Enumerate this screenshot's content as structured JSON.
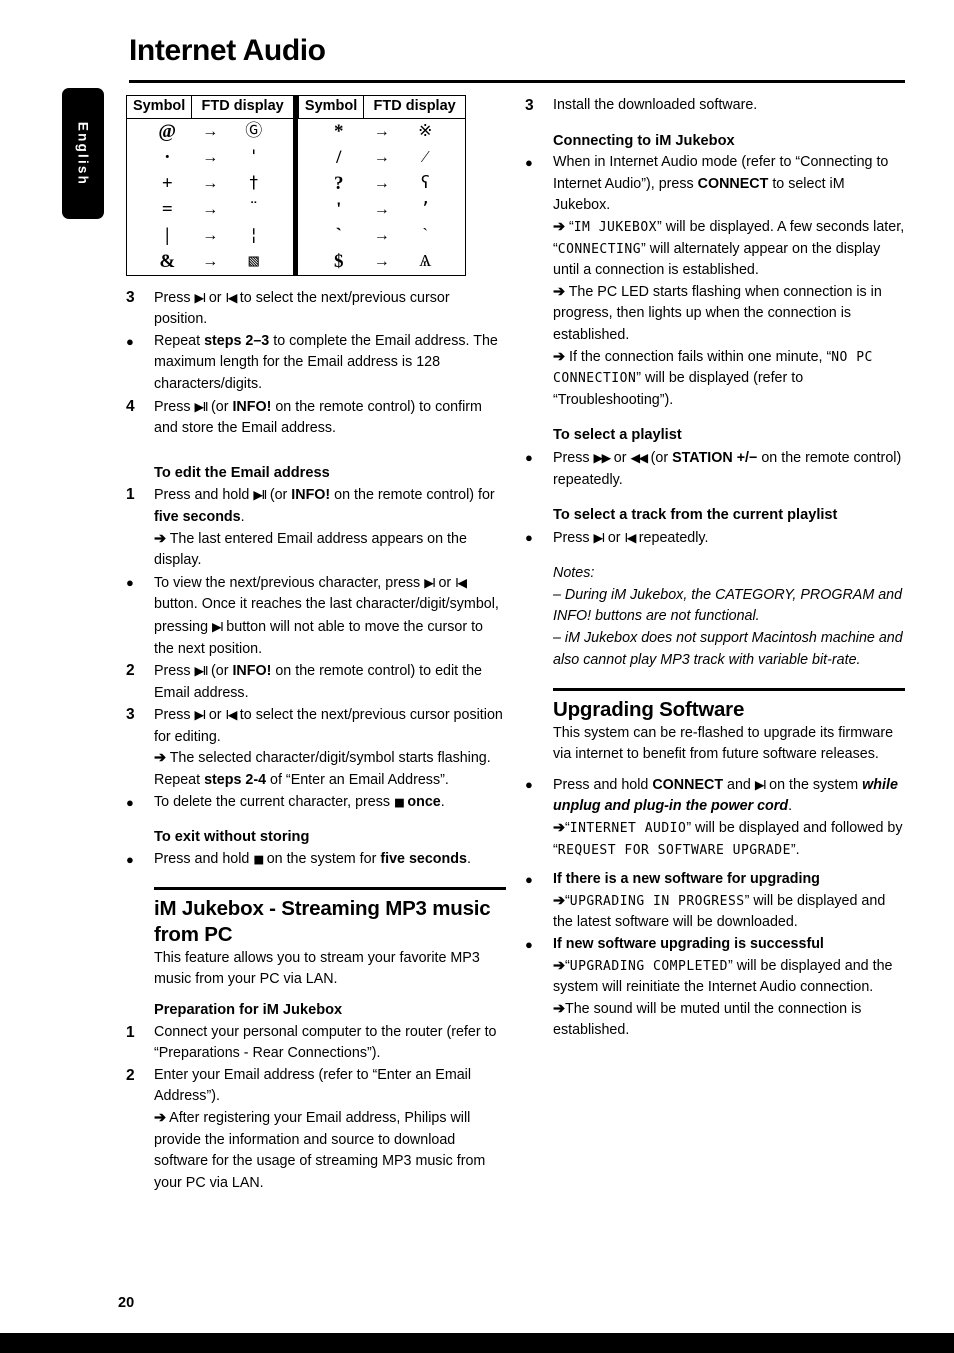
{
  "page": {
    "title": "Internet Audio",
    "language_tab": "English",
    "page_number": "20"
  },
  "symbol_table": {
    "headers": [
      "Symbol",
      "FTD display"
    ],
    "arrow": "→",
    "left_rows": [
      {
        "symbol": "@",
        "ftd": "Ⓖ"
      },
      {
        "symbol": "·",
        "ftd": "'"
      },
      {
        "symbol": "+",
        "ftd": "†"
      },
      {
        "symbol": "=",
        "ftd": "¨"
      },
      {
        "symbol": "|",
        "ftd": "¦"
      },
      {
        "symbol": "&",
        "ftd": "▧"
      }
    ],
    "right_rows": [
      {
        "symbol": "*",
        "ftd": "※"
      },
      {
        "symbol": "/",
        "ftd": "⁄"
      },
      {
        "symbol": "?",
        "ftd": "ʕ"
      },
      {
        "symbol": "'",
        "ftd": "’"
      },
      {
        "symbol": "`",
        "ftd": "ˋ"
      },
      {
        "symbol": "$",
        "ftd": "Ѧ"
      }
    ]
  },
  "left_column": {
    "step3": {
      "marker": "3",
      "text_a": "Press ",
      "key_next": "▶I",
      "text_b": " or ",
      "key_prev": "I◀",
      "text_c": " to select the next/previous cursor position."
    },
    "bullet_repeat": {
      "marker": "●",
      "text_a": "Repeat ",
      "bold": "steps 2–3",
      "text_b": " to complete the Email address. The maximum length for the Email address is 128 characters/digits."
    },
    "step4": {
      "marker": "4",
      "text_a": "Press ",
      "key_playpause": "▶II",
      "text_b": " (or ",
      "bold": "INFO!",
      "text_c": " on the remote control) to confirm and store the Email address."
    },
    "edit_heading": "To edit the Email address",
    "edit_step1": {
      "marker": "1",
      "text_a": "Press and hold ",
      "key_playpause": "▶II",
      "text_b": " (or ",
      "bold": "INFO!",
      "text_c": " on the remote control) for ",
      "bold2": "five seconds",
      "text_d": "."
    },
    "edit_step1_arrow": "The last entered Email address appears on the display.",
    "edit_bullet_view": {
      "marker": "●",
      "text_a": "To view the next/previous character, press ",
      "key_next": "▶I",
      "text_b": " or ",
      "key_prev": "I◀",
      "text_c": " button.  Once it reaches the last character/digit/symbol, pressing ",
      "key_next2": "▶I",
      "text_d": " button will not able to move the cursor to the next position."
    },
    "edit_step2": {
      "marker": "2",
      "text_a": "Press ",
      "key_playpause": "▶II",
      "text_b": " (or ",
      "bold": "INFO!",
      "text_c": " on the remote control) to edit the Email address."
    },
    "edit_step3": {
      "marker": "3",
      "text_a": "Press ",
      "key_next": "▶I",
      "text_b": " or ",
      "key_prev": "I◀",
      "text_c": " to select the next/previous cursor position for editing."
    },
    "edit_step3_arrow": {
      "text_a": "The selected character/digit/symbol starts flashing.  Repeat ",
      "bold": "steps 2-4",
      "text_b": " of “Enter an Email Address”."
    },
    "edit_bullet_delete": {
      "marker": "●",
      "text_a": "To delete the current character, press ",
      "key_stop": "■",
      "text_b": " ",
      "bold": "once",
      "text_c": "."
    },
    "exit_heading": "To exit without storing",
    "exit_bullet": {
      "marker": "●",
      "text_a": "Press and hold ",
      "key_stop": "■",
      "text_b": " on the system for ",
      "bold": "five seconds",
      "text_c": "."
    },
    "jukebox_heading": "iM Jukebox - Streaming MP3 music from PC",
    "jukebox_intro": "This feature allows you to stream your favorite MP3 music from your PC via LAN.",
    "prep_heading": "Preparation for iM Jukebox",
    "prep_step1": {
      "marker": "1",
      "text": "Connect your personal computer to the router (refer to “Preparations - Rear Connections”)."
    },
    "prep_step2": {
      "marker": "2",
      "text": "Enter your Email address (refer to “Enter an Email Address”)."
    },
    "prep_step2_arrow": "After registering your Email address, Philips will provide the information and source to download software for the usage of streaming MP3 music from your PC via LAN."
  },
  "right_column": {
    "step3": {
      "marker": "3",
      "text": "Install the downloaded software."
    },
    "connecting_heading": "Connecting to iM Jukebox",
    "connect_bullet": {
      "marker": "●",
      "text_a": "When in Internet Audio mode (refer to “Connecting to Internet Audio”), press ",
      "bold": "CONNECT",
      "text_b": " to select iM Jukebox."
    },
    "connect_arrow1": {
      "text_a": "“",
      "lcd1": "IM JUKEBOX",
      "text_b": "” will be displayed. A few seconds later, “",
      "lcd2": "CONNECTING",
      "text_c": "” will alternately appear on the display until a connection is established."
    },
    "connect_arrow2": "The PC LED starts flashing when connection is in progress, then lights up when the connection is established.",
    "connect_arrow3": {
      "text_a": "If the connection fails within one minute, “",
      "lcd": "NO PC CONNECTION",
      "text_b": "” will be displayed (refer to “Troubleshooting”)."
    },
    "playlist_heading": "To select a playlist",
    "playlist_bullet": {
      "marker": "●",
      "text_a": "Press ",
      "key_ff": "▶▶",
      "text_b": " or ",
      "key_rw": "◀◀",
      "text_c": " (or ",
      "bold": "STATION",
      "text_d": " +/−",
      "text_e": " on the remote control) repeatedly."
    },
    "track_heading": "To select a track from the current playlist",
    "track_bullet": {
      "marker": "●",
      "text_a": "Press ",
      "key_next": "▶I",
      "text_b": " or ",
      "key_prev": "I◀",
      "text_c": " repeatedly."
    },
    "notes_label": "Notes:",
    "note1": "–  During iM Jukebox, the CATEGORY, PROGRAM and INFO! buttons are not functional.",
    "note2": "–  iM Jukebox does not support Macintosh machine and also cannot play MP3 track with variable bit-rate.",
    "upgrade_heading": "Upgrading Software",
    "upgrade_intro": "This system can be re-flashed to upgrade its firmware via internet to benefit from future software releases.",
    "upgrade_bullet": {
      "marker": "●",
      "text_a": "Press and hold ",
      "bold": "CONNECT",
      "text_b": " and ",
      "key_next": "▶I",
      "text_c": " on the system ",
      "bolditalic": "while unplug and plug-in the power cord",
      "text_d": "."
    },
    "upgrade_arrow": {
      "text_a": "“",
      "lcd1": "INTERNET AUDIO",
      "text_b": "” will be displayed and followed by “",
      "lcd2": "REQUEST FOR SOFTWARE UPGRADE",
      "text_c": "”."
    },
    "new_sw_heading": {
      "marker": "●",
      "text": "If there is a new software for upgrading"
    },
    "new_sw_arrow": {
      "text_a": "“",
      "lcd": "UPGRADING IN PROGRESS",
      "text_b": "” will be displayed and the latest software will be downloaded."
    },
    "success_heading": {
      "marker": "●",
      "text": "If new software upgrading is successful"
    },
    "success_arrow": {
      "text_a": "“",
      "lcd": "UPGRADING COMPLETED",
      "text_b": "” will be displayed and the system will reinitiate the Internet Audio connection."
    },
    "mute_arrow": "The sound will be muted until the connection is established."
  }
}
